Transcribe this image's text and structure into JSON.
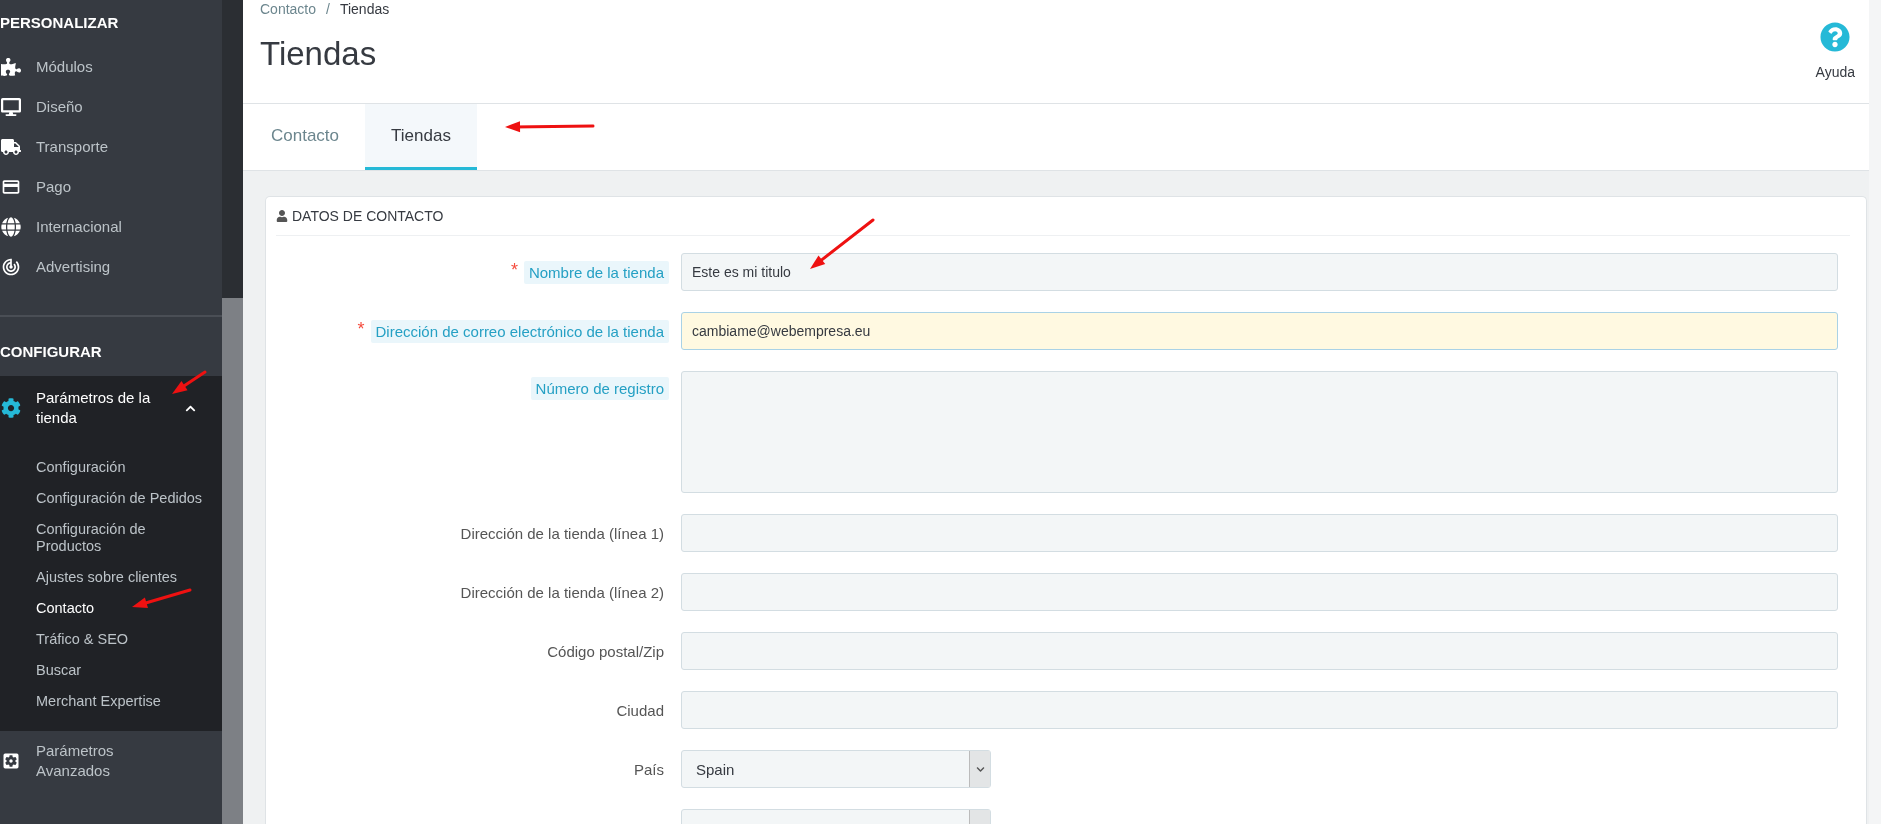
{
  "sidebar": {
    "sections": [
      {
        "title": "PERSONALIZAR",
        "items": [
          {
            "label": "Módulos",
            "expanded": false
          },
          {
            "label": "Diseño",
            "expanded": false
          },
          {
            "label": "Transporte",
            "expanded": false
          },
          {
            "label": "Pago",
            "expanded": false
          },
          {
            "label": "Internacional",
            "expanded": false
          },
          {
            "label": "Advertising",
            "expanded": false
          }
        ]
      },
      {
        "title": "CONFIGURAR",
        "items": [
          {
            "label": "Parámetros de la tienda",
            "expanded": true,
            "children": [
              {
                "label": "Configuración",
                "selected": false
              },
              {
                "label": "Configuración de Pedidos",
                "selected": false
              },
              {
                "label": "Configuración de Productos",
                "selected": false
              },
              {
                "label": "Ajustes sobre clientes",
                "selected": false
              },
              {
                "label": "Contacto",
                "selected": true
              },
              {
                "label": "Tráfico & SEO",
                "selected": false
              },
              {
                "label": "Buscar",
                "selected": false
              },
              {
                "label": "Merchant Expertise",
                "selected": false
              }
            ]
          },
          {
            "label": "Parámetros Avanzados",
            "expanded": false
          }
        ]
      }
    ]
  },
  "breadcrumb": {
    "items": [
      "Contacto",
      "Tiendas"
    ],
    "separator": "/"
  },
  "page_title": "Tiendas",
  "help_button": "Ayuda",
  "tabs": [
    {
      "label": "Contacto",
      "selected": false
    },
    {
      "label": "Tiendas",
      "selected": true
    }
  ],
  "panel": {
    "title": "DATOS DE CONTACTO",
    "rows": [
      {
        "kind": "text",
        "label": "Nombre de la tienda",
        "required_mark": "*",
        "label_highlighted": true,
        "value": "Este es mi titulo",
        "highlighted": false
      },
      {
        "kind": "text",
        "label": "Dirección de correo electrónico de la tienda",
        "required_mark": "*",
        "label_highlighted": true,
        "value": "cambiame@webempresa.eu",
        "highlighted": true
      },
      {
        "kind": "textarea",
        "label": "Número de registro",
        "label_highlighted": true,
        "highlighted": false
      },
      {
        "kind": "text",
        "label": "Dirección de la tienda (línea 1)",
        "label_highlighted": false,
        "highlighted": false
      },
      {
        "kind": "text",
        "label": "Dirección de la tienda (línea 2)",
        "label_highlighted": false,
        "highlighted": false
      },
      {
        "kind": "text",
        "label": "Código postal/Zip",
        "label_highlighted": false,
        "highlighted": false
      },
      {
        "kind": "text",
        "label": "Ciudad",
        "label_highlighted": false,
        "highlighted": false
      },
      {
        "kind": "select",
        "label": "País",
        "label_highlighted": false,
        "value": "Spain",
        "highlighted": false
      },
      {
        "kind": "select",
        "highlighted": false
      }
    ]
  },
  "annotation_arrows": [
    {
      "kind": "sidebar_item"
    },
    {
      "kind": "sidebar_subitem"
    },
    {
      "kind": "tab"
    },
    {
      "kind": "field"
    }
  ]
}
